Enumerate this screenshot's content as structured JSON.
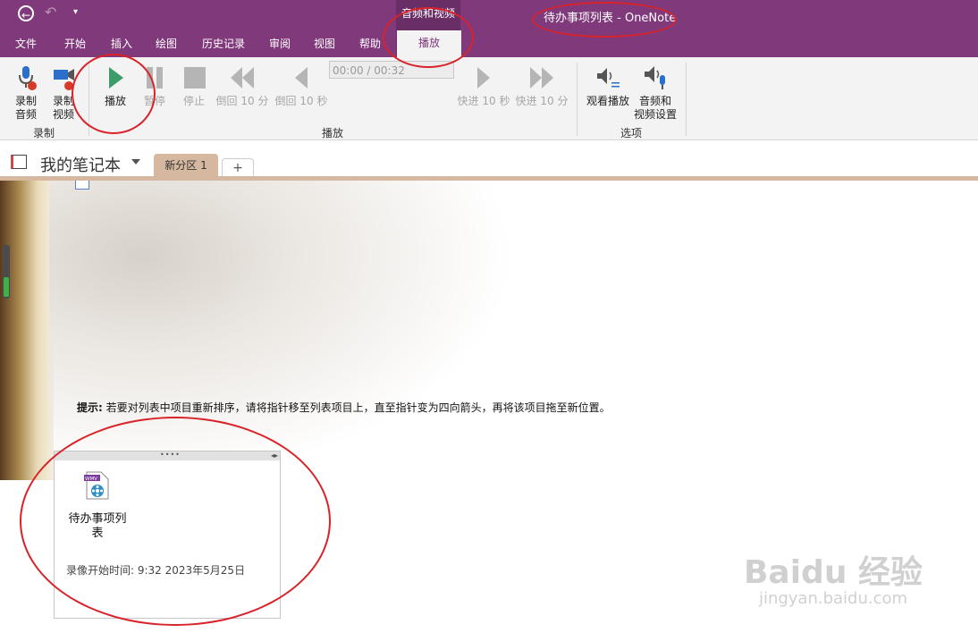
{
  "qat": {
    "back_icon": "back-arrow-icon",
    "undo_icon": "undo-icon",
    "more_icon": "customize-qat-icon"
  },
  "context_group": "音频和视频",
  "app_title": "待办事项列表  -  OneNote",
  "menu_tabs": [
    "文件",
    "开始",
    "插入",
    "绘图",
    "历史记录",
    "审阅",
    "视图",
    "帮助",
    "播放"
  ],
  "active_tab": "播放",
  "ribbon": {
    "record_audio": "录制\n音频",
    "record_video": "录制\n视频",
    "play": "播放",
    "pause": "暂停",
    "stop": "停止",
    "rewind_10m": "倒回 10 分",
    "rewind_10s": "倒回 10 秒",
    "time": "00:00 / 00:32",
    "forward_10s": "快进 10 秒",
    "forward_10m": "快进 10 分",
    "see_playback": "观看播放",
    "av_settings": "音频和\n视频设置",
    "group_record": "录制",
    "group_play": "播放",
    "group_options": "选项"
  },
  "notebook": {
    "name": "我的笔记本",
    "section_tab": "新分区 1",
    "add_tab": "+"
  },
  "page": {
    "tip_bold": "提示:",
    "tip_text": " 若要对列表中项目重新排序，请将指针移至列表项目上，直至指针变为四向箭头，再将该项目拖至新位置。",
    "media_file_label": "待办事项列表",
    "media_file_badge": "WMV",
    "record_time": "录像开始时间: 9:32 2023年5月25日"
  },
  "watermark": {
    "main": "Baidu 经验",
    "sub": "jingyan.baidu.com"
  },
  "colors": {
    "accent": "#80397B",
    "annotation": "#d8232a",
    "play_green": "#3c9c6c"
  }
}
